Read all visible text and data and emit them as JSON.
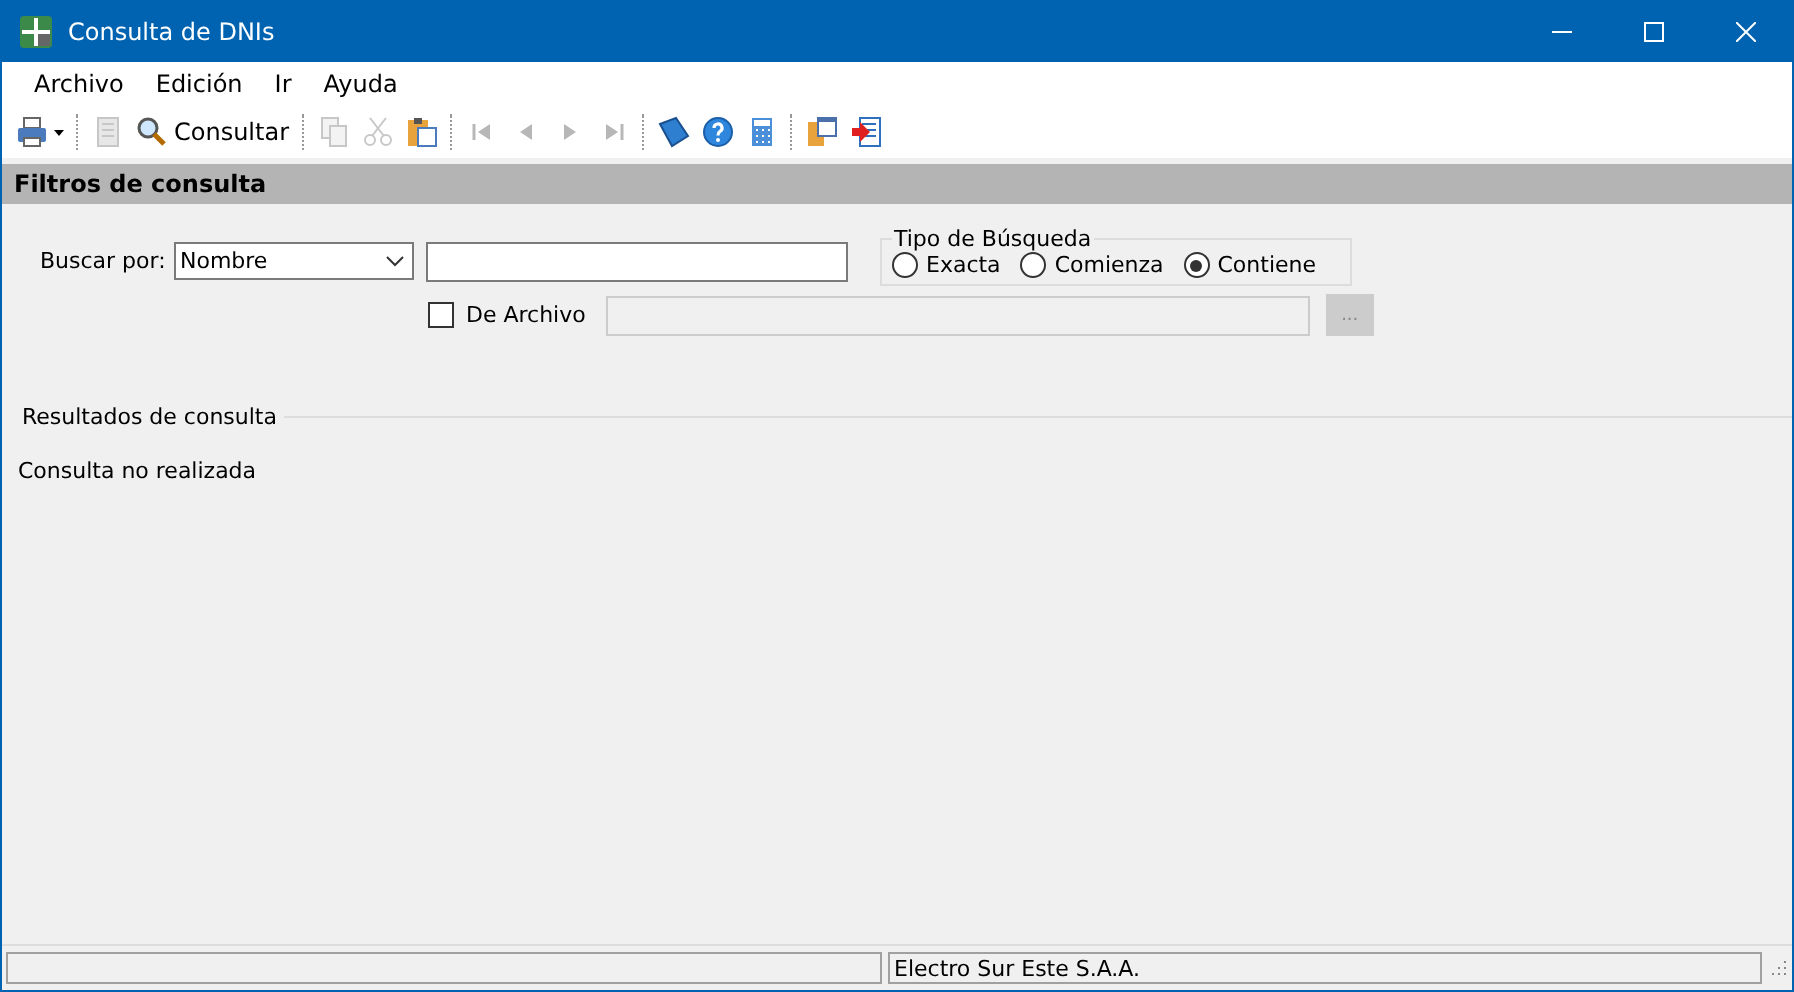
{
  "window": {
    "title": "Consulta de DNIs"
  },
  "menu": [
    "Archivo",
    "Edición",
    "Ir",
    "Ayuda"
  ],
  "toolbar": [
    {
      "kind": "icon",
      "disabled": false,
      "dropdown": true
    },
    {
      "kind": "separator"
    },
    {
      "kind": "icon",
      "disabled": true
    },
    {
      "kind": "text",
      "label": "Consultar",
      "disabled": false
    },
    {
      "kind": "separator"
    },
    {
      "kind": "icon",
      "disabled": true
    },
    {
      "kind": "icon",
      "disabled": true
    },
    {
      "kind": "icon",
      "disabled": false
    },
    {
      "kind": "separator"
    },
    {
      "kind": "icon",
      "disabled": true
    },
    {
      "kind": "icon",
      "disabled": true
    },
    {
      "kind": "icon",
      "disabled": true
    },
    {
      "kind": "icon",
      "disabled": true
    },
    {
      "kind": "separator"
    },
    {
      "kind": "icon",
      "disabled": false
    },
    {
      "kind": "icon",
      "disabled": false
    },
    {
      "kind": "icon",
      "disabled": false
    },
    {
      "kind": "separator"
    },
    {
      "kind": "icon",
      "disabled": false
    },
    {
      "kind": "icon",
      "disabled": false
    }
  ],
  "filters": {
    "header": "Filtros de consulta",
    "search_by_label": "Buscar por:",
    "search_by_value": "Nombre",
    "search_type": {
      "title": "Tipo de Búsqueda",
      "options": [
        {
          "label": "Exacta",
          "selected": false
        },
        {
          "label": "Comienza",
          "selected": false
        },
        {
          "label": "Contiene",
          "selected": true
        }
      ]
    },
    "from_file": {
      "label": "De Archivo",
      "checked": false,
      "disabled": true,
      "browse": "..."
    }
  },
  "results": {
    "title": "Resultados de consulta",
    "message": "Consulta no realizada"
  },
  "status_bar": {
    "company": "Electro Sur Este S.A.A."
  }
}
